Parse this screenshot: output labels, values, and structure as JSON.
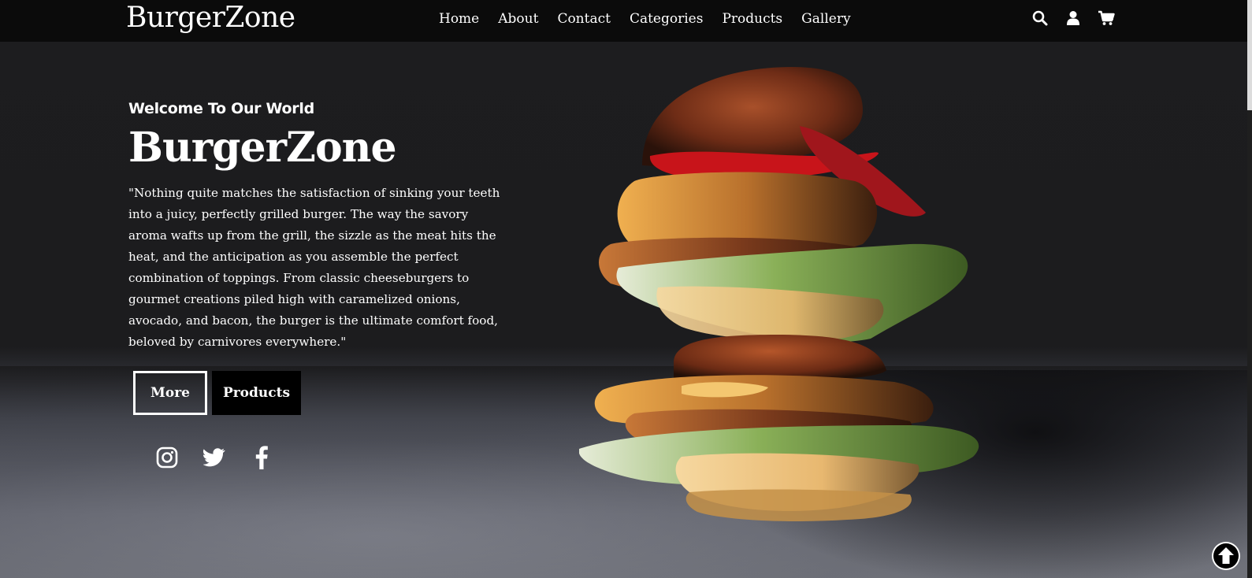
{
  "nav": {
    "brand": "BurgerZone",
    "links": [
      "Home",
      "About",
      "Contact",
      "Categories",
      "Products",
      "Gallery"
    ],
    "icons": [
      "search-icon",
      "user-icon",
      "cart-icon"
    ]
  },
  "hero": {
    "welcome": "Welcome To Our World",
    "title": "BurgerZone",
    "quote": "\"Nothing quite matches the satisfaction of sinking your teeth into a juicy, perfectly grilled burger. The way the savory aroma wafts up from the grill, the sizzle as the meat hits the heat, and the anticipation as you assemble the perfect combination of toppings. From classic cheeseburgers to gourmet creations piled high with caramelized onions, avocado, and bacon, the burger is the ultimate comfort food, beloved by carnivores everywhere.\"",
    "more_label": "More",
    "products_label": "Products"
  },
  "socials": [
    "instagram-icon",
    "twitter-icon",
    "facebook-icon"
  ],
  "scroll_to_top": "arrow-up-circle-icon",
  "colors": {
    "nav_background": "#0b0b0b",
    "hero_background": "#1c1c1e",
    "text": "#ffffff",
    "products_button": "#000000"
  }
}
